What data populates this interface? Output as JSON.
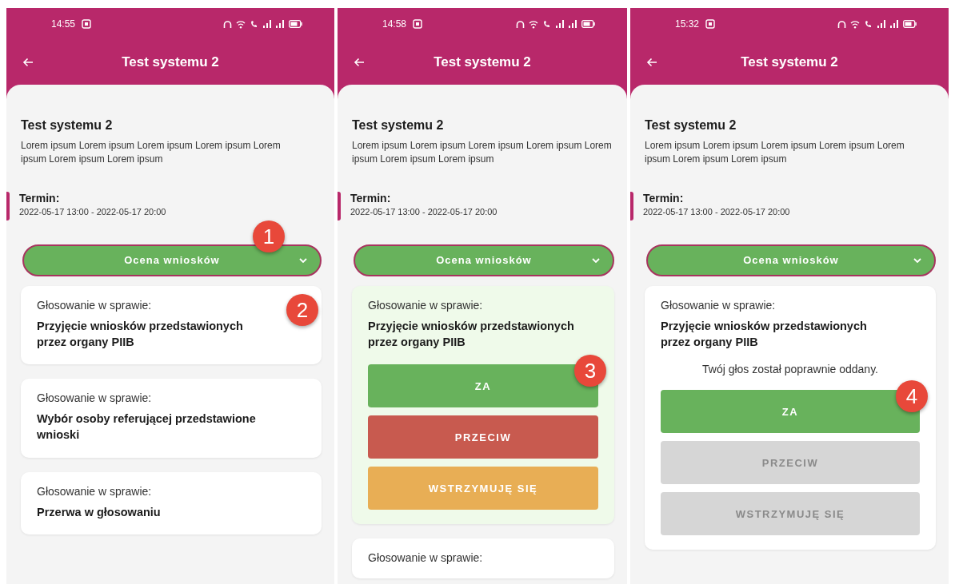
{
  "screens": [
    {
      "status": {
        "time": "14:55"
      },
      "app_bar": {
        "title": "Test systemu 2"
      },
      "event": {
        "title": "Test systemu 2",
        "description": "Lorem ipsum Lorem ipsum Lorem ipsum Lorem ipsum Lorem ipsum Lorem ipsum Lorem ipsum",
        "term_label": "Termin:",
        "term": "2022-05-17 13:00 - 2022-05-17 20:00"
      },
      "dropdown": {
        "label": "Ocena wniosków",
        "callout": "1"
      },
      "votes": [
        {
          "heading": "Głosowanie w sprawie:",
          "subject": "Przyjęcie wniosków przedstawionych przez organy PIIB",
          "selected": false,
          "callout": "2"
        },
        {
          "heading": "Głosowanie w sprawie:",
          "subject": "Wybór osoby referującej przedstawione wnioski",
          "selected": false
        },
        {
          "heading": "Głosowanie w sprawie:",
          "subject": "Przerwa w głosowaniu",
          "selected": false
        }
      ]
    },
    {
      "status": {
        "time": "14:58"
      },
      "app_bar": {
        "title": "Test systemu 2"
      },
      "event": {
        "title": "Test systemu 2",
        "description": "Lorem ipsum Lorem ipsum Lorem ipsum Lorem ipsum Lorem ipsum Lorem ipsum Lorem ipsum",
        "term_label": "Termin:",
        "term": "2022-05-17 13:00 - 2022-05-17 20:00"
      },
      "dropdown": {
        "label": "Ocena wniosków"
      },
      "votes": [
        {
          "heading": "Głosowanie w sprawie:",
          "subject": "Przyjęcie wniosków przedstawionych przez organy PIIB",
          "selected": true,
          "buttons": [
            {
              "label": "ZA",
              "kind": "for",
              "disabled": false,
              "callout": "3"
            },
            {
              "label": "PRZECIW",
              "kind": "against",
              "disabled": false
            },
            {
              "label": "WSTRZYMUJĘ SIĘ",
              "kind": "abstain",
              "disabled": false
            }
          ]
        },
        {
          "heading": "Głosowanie w sprawie:",
          "selected": false
        }
      ]
    },
    {
      "status": {
        "time": "15:32"
      },
      "app_bar": {
        "title": "Test systemu 2"
      },
      "event": {
        "title": "Test systemu 2",
        "description": "Lorem ipsum Lorem ipsum Lorem ipsum Lorem ipsum Lorem ipsum Lorem ipsum Lorem ipsum",
        "term_label": "Termin:",
        "term": "2022-05-17 13:00 - 2022-05-17 20:00"
      },
      "dropdown": {
        "label": "Ocena wniosków"
      },
      "votes": [
        {
          "heading": "Głosowanie w sprawie:",
          "subject": "Przyjęcie wniosków przedstawionych przez organy PIIB",
          "selected": false,
          "message": "Twój głos został poprawnie oddany.",
          "buttons": [
            {
              "label": "ZA",
              "kind": "for",
              "disabled": false,
              "callout": "4"
            },
            {
              "label": "PRZECIW",
              "kind": "against",
              "disabled": true
            },
            {
              "label": "WSTRZYMUJĘ SIĘ",
              "kind": "abstain",
              "disabled": true
            }
          ]
        }
      ]
    }
  ]
}
